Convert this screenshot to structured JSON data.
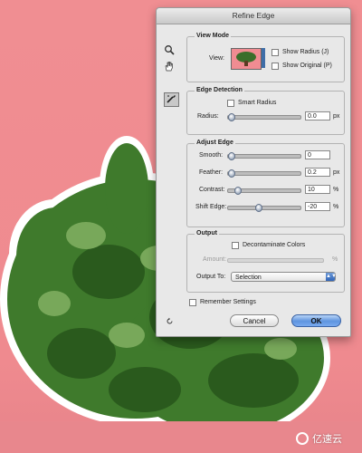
{
  "dialog": {
    "title": "Refine Edge"
  },
  "tools": {
    "zoom": "zoom-icon",
    "hand": "hand-icon",
    "refine": "refine-radius-brush-icon"
  },
  "view_mode": {
    "label": "View Mode",
    "view_label": "View:",
    "show_radius": {
      "label": "Show Radius (J)",
      "checked": false
    },
    "show_original": {
      "label": "Show Original (P)",
      "checked": false
    }
  },
  "edge_detection": {
    "label": "Edge Detection",
    "smart_radius": {
      "label": "Smart Radius",
      "checked": false
    },
    "radius": {
      "label": "Radius:",
      "value": "0.0",
      "unit": "px",
      "level": 0.0
    }
  },
  "adjust_edge": {
    "label": "Adjust Edge",
    "smooth": {
      "label": "Smooth:",
      "value": "0",
      "unit": "",
      "level": 0.0
    },
    "feather": {
      "label": "Feather:",
      "value": "0.2",
      "unit": "px",
      "level": 0.0
    },
    "contrast": {
      "label": "Contrast:",
      "value": "10",
      "unit": "%",
      "level": 0.1
    },
    "shift_edge": {
      "label": "Shift Edge:",
      "value": "-20",
      "unit": "%",
      "level": 0.4
    }
  },
  "output": {
    "label": "Output",
    "decontaminate": {
      "label": "Decontaminate Colors",
      "checked": false
    },
    "amount": {
      "label": "Amount:",
      "unit": "%"
    },
    "output_to": {
      "label": "Output To:",
      "value": "Selection"
    }
  },
  "remember_settings": {
    "label": "Remember Settings",
    "checked": false
  },
  "buttons": {
    "cancel": "Cancel",
    "ok": "OK"
  },
  "watermark": {
    "text": "亿速云"
  },
  "colors": {
    "background": "#f08e92",
    "dialog": "#e8e8e8",
    "ok_button": "#5e94df",
    "tree": "#3a6e2a"
  }
}
